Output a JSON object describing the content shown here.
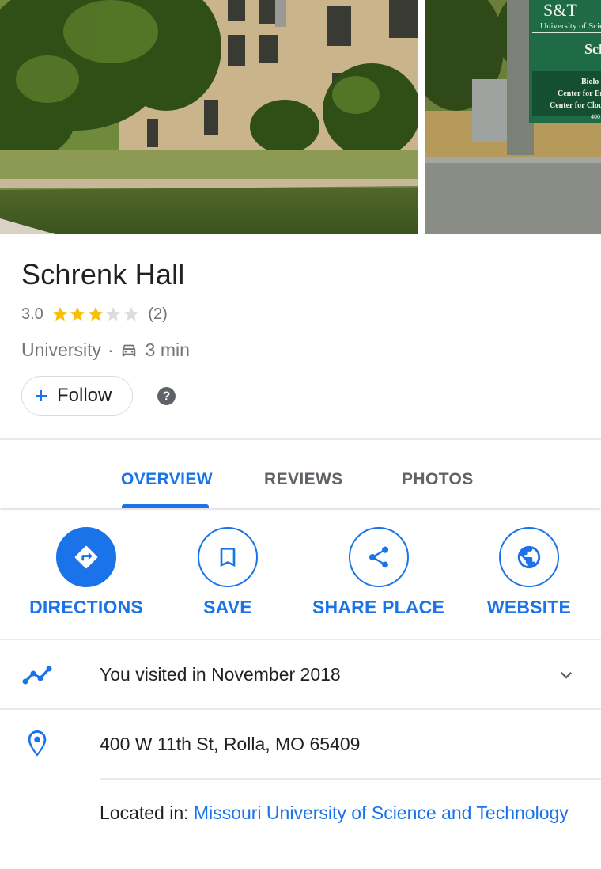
{
  "place": {
    "title": "Schrenk Hall",
    "rating": "3.0",
    "rating_value": 3,
    "rating_max": 5,
    "review_count": "(2)",
    "category": "University",
    "separator": "·",
    "drive_time": "3 min"
  },
  "follow": {
    "label": "Follow"
  },
  "tabs": [
    {
      "label": "OVERVIEW",
      "active": true
    },
    {
      "label": "REVIEWS",
      "active": false
    },
    {
      "label": "PHOTOS",
      "active": false
    }
  ],
  "actions": {
    "directions": "DIRECTIONS",
    "save": "SAVE",
    "share": "SHARE PLACE",
    "website": "WEBSITE"
  },
  "visit": {
    "text": "You visited in November 2018"
  },
  "address": {
    "text": "400 W 11th St, Rolla, MO 65409"
  },
  "located_in": {
    "label": "Located in: ",
    "link": "Missouri University of Science and Technology"
  },
  "sign": {
    "logo": "S&T",
    "line1": "University of Scien",
    "line2": "Sch",
    "line3": "Biolo",
    "line4": "Center for En",
    "line5": "Center for Clou",
    "line6": "400"
  },
  "colors": {
    "accent": "#1a73e8",
    "star": "#fbbc04",
    "star_empty": "#dadce0",
    "text_secondary": "#70757a"
  }
}
